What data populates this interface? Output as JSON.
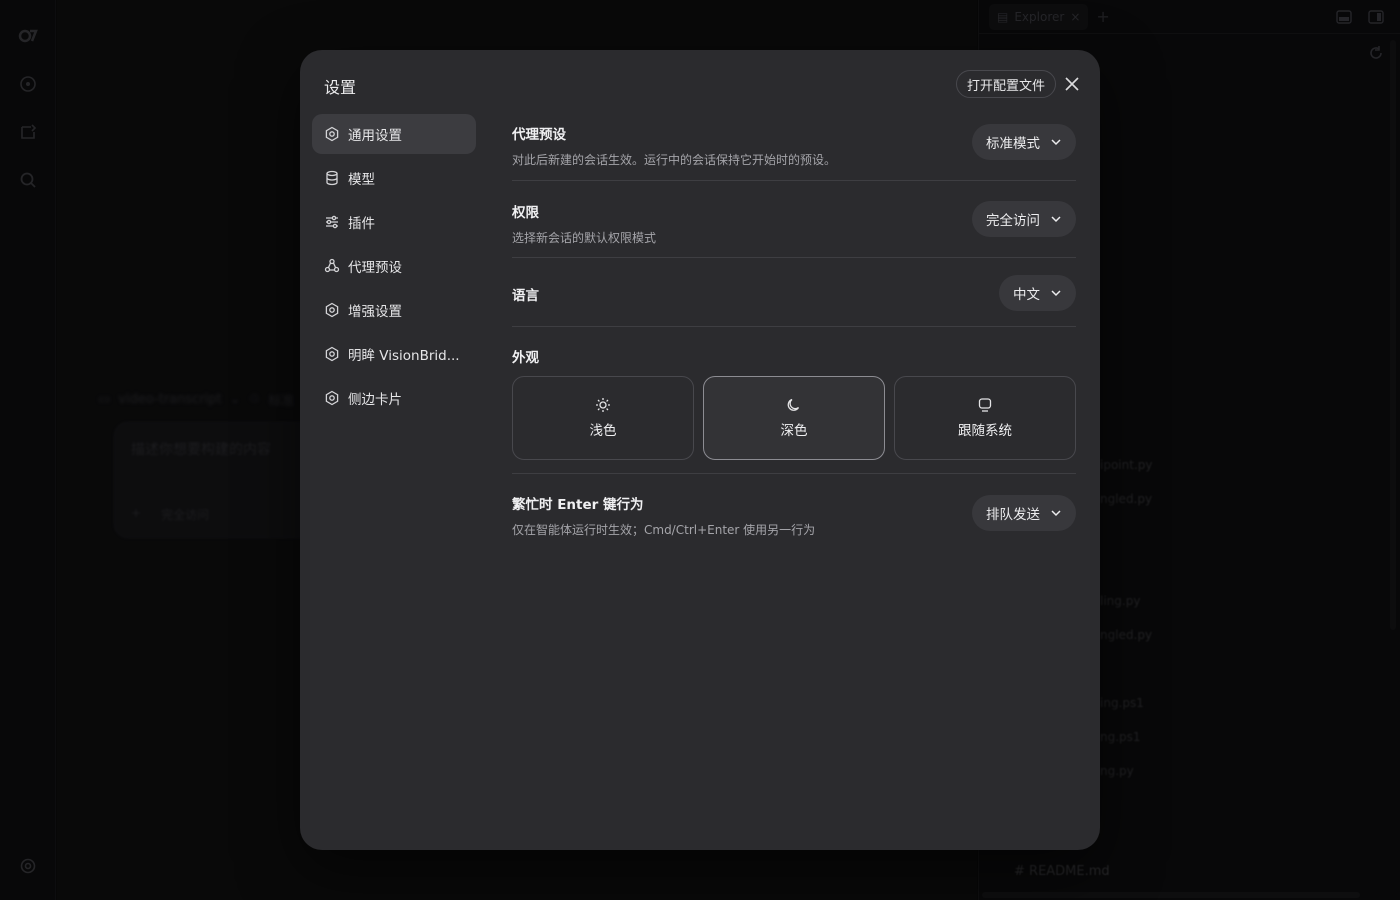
{
  "background": {
    "breadcrumb": {
      "project": "video-transcript",
      "mode": "标准"
    },
    "composer": {
      "placeholder": "描述你想要构建的内容",
      "access": "完全访问"
    },
    "explorer": {
      "tab_label": "Explorer",
      "partial_items": [
        "ipoint.py",
        "ngled.py",
        "ling.py",
        "ngled.py",
        "ing.ps1",
        "ng.ps1",
        "ng.py"
      ],
      "readme": "README.md"
    }
  },
  "modal": {
    "title": "设置",
    "open_config_label": "打开配置文件",
    "sidebar": [
      {
        "label": "通用设置",
        "icon": "gear-icon",
        "active": true
      },
      {
        "label": "模型",
        "icon": "database-icon",
        "active": false
      },
      {
        "label": "插件",
        "icon": "sliders-icon",
        "active": false
      },
      {
        "label": "代理预设",
        "icon": "agent-icon",
        "active": false
      },
      {
        "label": "增强设置",
        "icon": "gear-icon",
        "active": false
      },
      {
        "label": "明眸 VisionBrid...",
        "icon": "gear-icon",
        "active": false
      },
      {
        "label": "侧边卡片",
        "icon": "gear-icon",
        "active": false
      }
    ],
    "settings": {
      "agent_preset": {
        "title": "代理预设",
        "desc": "对此后新建的会话生效。运行中的会话保持它开始时的预设。",
        "value": "标准模式"
      },
      "permission": {
        "title": "权限",
        "desc": "选择新会话的默认权限模式",
        "value": "完全访问"
      },
      "language": {
        "title": "语言",
        "value": "中文"
      },
      "appearance": {
        "title": "外观",
        "options": [
          {
            "label": "浅色",
            "icon": "sun-icon"
          },
          {
            "label": "深色",
            "icon": "moon-icon"
          },
          {
            "label": "跟随系统",
            "icon": "monitor-icon"
          }
        ],
        "selected": "深色"
      },
      "busy_enter": {
        "title": "繁忙时 Enter 键行为",
        "desc": "仅在智能体运行时生效；Cmd/Ctrl+Enter 使用另一行为",
        "value": "排队发送"
      }
    }
  }
}
